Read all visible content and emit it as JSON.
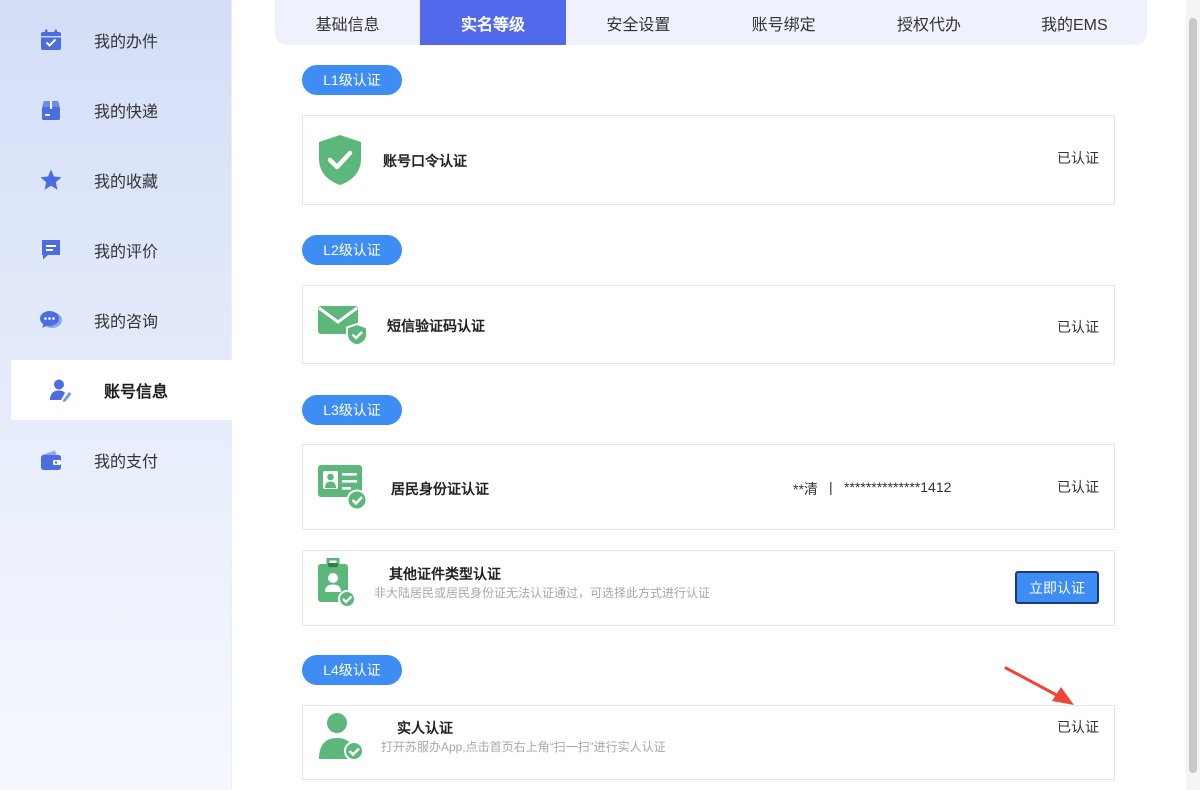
{
  "sidebar": {
    "items": [
      {
        "label": "我的办件",
        "icon": "calendar-check-icon"
      },
      {
        "label": "我的快递",
        "icon": "package-icon"
      },
      {
        "label": "我的收藏",
        "icon": "star-icon"
      },
      {
        "label": "我的评价",
        "icon": "comment-icon"
      },
      {
        "label": "我的咨询",
        "icon": "chat-bubbles-icon"
      },
      {
        "label": "账号信息",
        "icon": "user-edit-icon",
        "active": true
      },
      {
        "label": "我的支付",
        "icon": "wallet-icon"
      }
    ]
  },
  "tabs": [
    {
      "label": "基础信息"
    },
    {
      "label": "实名等级",
      "active": true
    },
    {
      "label": "安全设置"
    },
    {
      "label": "账号绑定"
    },
    {
      "label": "授权代办"
    },
    {
      "label": "我的EMS"
    }
  ],
  "levels": {
    "l1": {
      "label": "L1级认证",
      "cards": [
        {
          "title": "账号口令认证",
          "status": "已认证",
          "icon": "shield-check-icon"
        }
      ]
    },
    "l2": {
      "label": "L2级认证",
      "cards": [
        {
          "title": "短信验证码认证",
          "status": "已认证",
          "icon": "envelope-shield-icon"
        }
      ]
    },
    "l3": {
      "label": "L3级认证",
      "cards": [
        {
          "title": "居民身份证认证",
          "masked_name": "**清",
          "separator": "|",
          "masked_id": "**************1412",
          "status": "已认证",
          "icon": "id-card-icon"
        },
        {
          "title": "其他证件类型认证",
          "description": "非大陆居民或居民身份证无法认证通过，可选择此方式进行认证",
          "button": "立即认证",
          "icon": "badge-icon"
        }
      ]
    },
    "l4": {
      "label": "L4级认证",
      "cards": [
        {
          "title": "实人认证",
          "description": "打开苏服办App,点击首页右上角“扫一扫”进行实人认证",
          "status": "已认证",
          "icon": "person-check-icon"
        }
      ]
    }
  },
  "colors": {
    "accent": "#5369eb",
    "pill": "#3d8df5",
    "icon_green": "#5cb77a",
    "icon_blue": "#4a6ee0",
    "annotation_arrow": "#f04437"
  }
}
